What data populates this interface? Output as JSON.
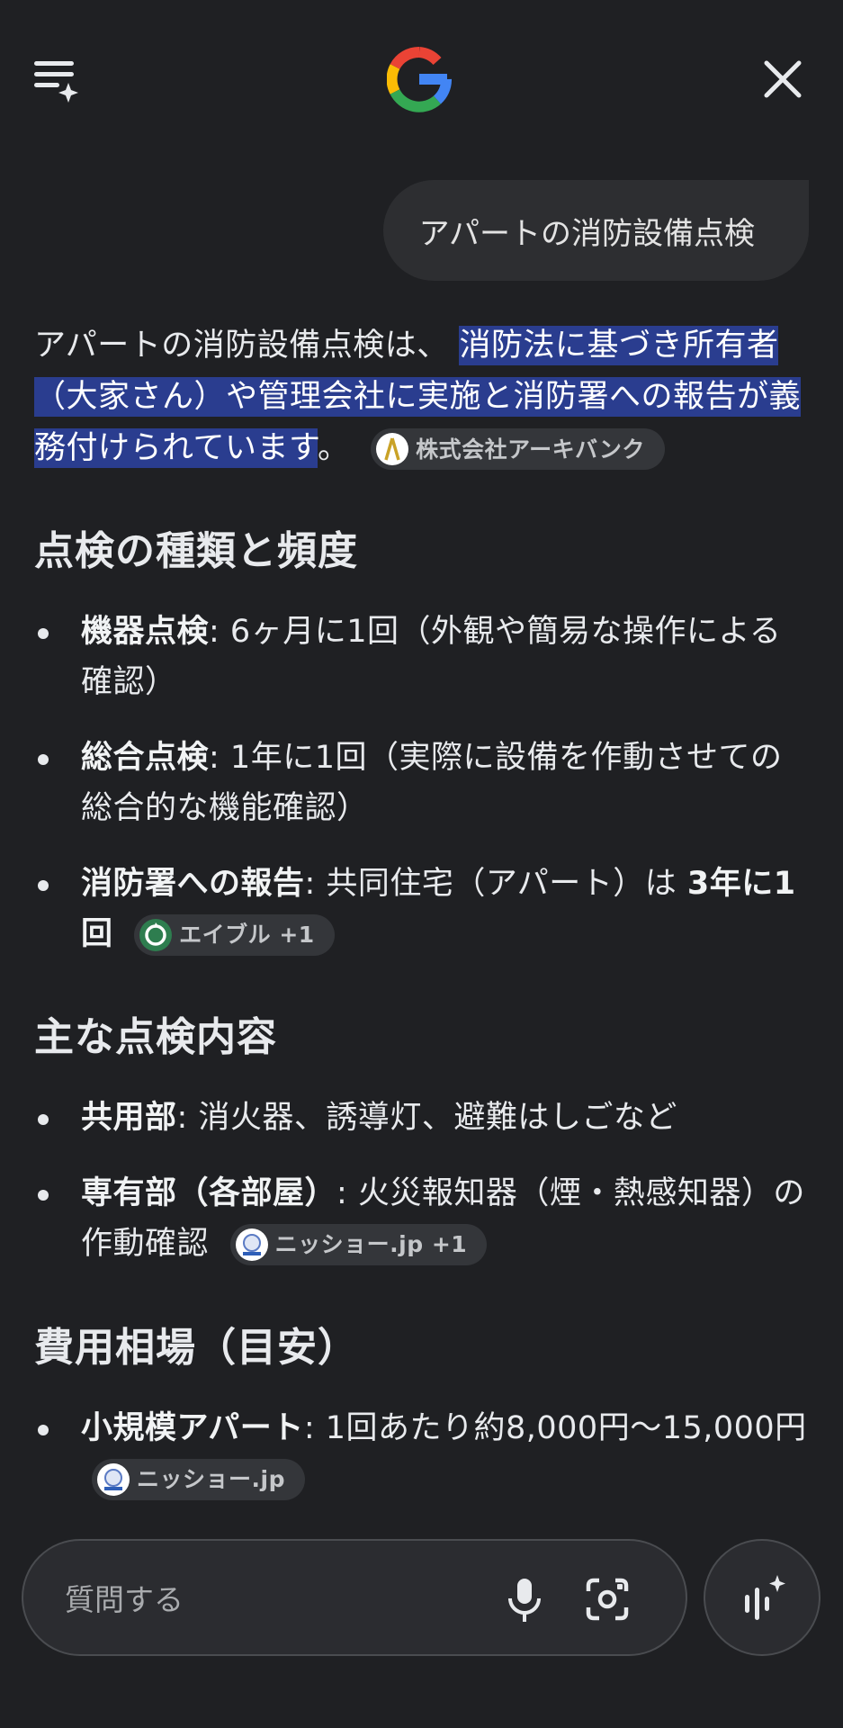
{
  "header": {
    "menu_icon": "menu-sparkle-icon",
    "logo_icon": "google-g-icon",
    "close_icon": "close-icon"
  },
  "query": "アパートの消防設備点検",
  "answer": {
    "intro_plain": "アパートの消防設備点検は、",
    "intro_highlight": "消防法に基づき所有者（大家さん）や管理会社に実施と消防署への報告が義務付けられています",
    "intro_end": "。",
    "intro_source": "株式会社アーキバンク"
  },
  "sections": {
    "types": {
      "heading": "点検の種類と頻度",
      "items": [
        {
          "label": "機器点検",
          "text": ": 6ヶ月に1回（外観や簡易な操作による確認）"
        },
        {
          "label": "総合点検",
          "text": ": 1年に1回（実際に設備を作動させての総合的な機能確認）"
        },
        {
          "label": "消防署への報告",
          "text": ": 共同住宅（アパート）は ",
          "bold_tail": "3年に1回",
          "source": "エイブル +1"
        }
      ]
    },
    "content": {
      "heading": "主な点検内容",
      "items": [
        {
          "label": "共用部",
          "text": ": 消火器、誘導灯、避難はしごなど"
        },
        {
          "label": "専有部（各部屋）",
          "text": ": 火災報知器（煙・熱感知器）の作動確認",
          "source": "ニッショー.jp +1"
        }
      ]
    },
    "cost": {
      "heading": "費用相場（目安）",
      "items": [
        {
          "label": "小規模アパート",
          "text": ": 1回あたり約8,000円〜15,000円",
          "source": "ニッショー.jp"
        }
      ]
    }
  },
  "input": {
    "placeholder": "質問する",
    "mic_icon": "microphone-icon",
    "lens_icon": "camera-lens-icon",
    "voice_icon": "live-voice-icon"
  },
  "colors": {
    "background": "#1f2023",
    "highlight": "#2a3d8f",
    "chip": "#34363a",
    "bubble": "#2d2e31"
  }
}
